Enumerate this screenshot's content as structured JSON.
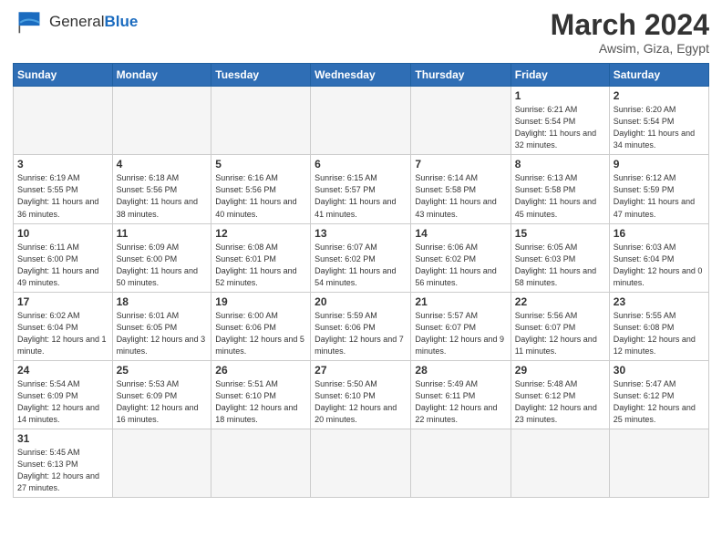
{
  "header": {
    "logo_general": "General",
    "logo_blue": "Blue",
    "month": "March 2024",
    "location": "Awsim, Giza, Egypt"
  },
  "days_of_week": [
    "Sunday",
    "Monday",
    "Tuesday",
    "Wednesday",
    "Thursday",
    "Friday",
    "Saturday"
  ],
  "weeks": [
    [
      {
        "day": "",
        "info": "",
        "empty": true
      },
      {
        "day": "",
        "info": "",
        "empty": true
      },
      {
        "day": "",
        "info": "",
        "empty": true
      },
      {
        "day": "",
        "info": "",
        "empty": true
      },
      {
        "day": "",
        "info": "",
        "empty": true
      },
      {
        "day": "1",
        "info": "Sunrise: 6:21 AM\nSunset: 5:54 PM\nDaylight: 11 hours\nand 32 minutes."
      },
      {
        "day": "2",
        "info": "Sunrise: 6:20 AM\nSunset: 5:54 PM\nDaylight: 11 hours\nand 34 minutes."
      }
    ],
    [
      {
        "day": "3",
        "info": "Sunrise: 6:19 AM\nSunset: 5:55 PM\nDaylight: 11 hours\nand 36 minutes."
      },
      {
        "day": "4",
        "info": "Sunrise: 6:18 AM\nSunset: 5:56 PM\nDaylight: 11 hours\nand 38 minutes."
      },
      {
        "day": "5",
        "info": "Sunrise: 6:16 AM\nSunset: 5:56 PM\nDaylight: 11 hours\nand 40 minutes."
      },
      {
        "day": "6",
        "info": "Sunrise: 6:15 AM\nSunset: 5:57 PM\nDaylight: 11 hours\nand 41 minutes."
      },
      {
        "day": "7",
        "info": "Sunrise: 6:14 AM\nSunset: 5:58 PM\nDaylight: 11 hours\nand 43 minutes."
      },
      {
        "day": "8",
        "info": "Sunrise: 6:13 AM\nSunset: 5:58 PM\nDaylight: 11 hours\nand 45 minutes."
      },
      {
        "day": "9",
        "info": "Sunrise: 6:12 AM\nSunset: 5:59 PM\nDaylight: 11 hours\nand 47 minutes."
      }
    ],
    [
      {
        "day": "10",
        "info": "Sunrise: 6:11 AM\nSunset: 6:00 PM\nDaylight: 11 hours\nand 49 minutes."
      },
      {
        "day": "11",
        "info": "Sunrise: 6:09 AM\nSunset: 6:00 PM\nDaylight: 11 hours\nand 50 minutes."
      },
      {
        "day": "12",
        "info": "Sunrise: 6:08 AM\nSunset: 6:01 PM\nDaylight: 11 hours\nand 52 minutes."
      },
      {
        "day": "13",
        "info": "Sunrise: 6:07 AM\nSunset: 6:02 PM\nDaylight: 11 hours\nand 54 minutes."
      },
      {
        "day": "14",
        "info": "Sunrise: 6:06 AM\nSunset: 6:02 PM\nDaylight: 11 hours\nand 56 minutes."
      },
      {
        "day": "15",
        "info": "Sunrise: 6:05 AM\nSunset: 6:03 PM\nDaylight: 11 hours\nand 58 minutes."
      },
      {
        "day": "16",
        "info": "Sunrise: 6:03 AM\nSunset: 6:04 PM\nDaylight: 12 hours\nand 0 minutes."
      }
    ],
    [
      {
        "day": "17",
        "info": "Sunrise: 6:02 AM\nSunset: 6:04 PM\nDaylight: 12 hours\nand 1 minute."
      },
      {
        "day": "18",
        "info": "Sunrise: 6:01 AM\nSunset: 6:05 PM\nDaylight: 12 hours\nand 3 minutes."
      },
      {
        "day": "19",
        "info": "Sunrise: 6:00 AM\nSunset: 6:06 PM\nDaylight: 12 hours\nand 5 minutes."
      },
      {
        "day": "20",
        "info": "Sunrise: 5:59 AM\nSunset: 6:06 PM\nDaylight: 12 hours\nand 7 minutes."
      },
      {
        "day": "21",
        "info": "Sunrise: 5:57 AM\nSunset: 6:07 PM\nDaylight: 12 hours\nand 9 minutes."
      },
      {
        "day": "22",
        "info": "Sunrise: 5:56 AM\nSunset: 6:07 PM\nDaylight: 12 hours\nand 11 minutes."
      },
      {
        "day": "23",
        "info": "Sunrise: 5:55 AM\nSunset: 6:08 PM\nDaylight: 12 hours\nand 12 minutes."
      }
    ],
    [
      {
        "day": "24",
        "info": "Sunrise: 5:54 AM\nSunset: 6:09 PM\nDaylight: 12 hours\nand 14 minutes."
      },
      {
        "day": "25",
        "info": "Sunrise: 5:53 AM\nSunset: 6:09 PM\nDaylight: 12 hours\nand 16 minutes."
      },
      {
        "day": "26",
        "info": "Sunrise: 5:51 AM\nSunset: 6:10 PM\nDaylight: 12 hours\nand 18 minutes."
      },
      {
        "day": "27",
        "info": "Sunrise: 5:50 AM\nSunset: 6:10 PM\nDaylight: 12 hours\nand 20 minutes."
      },
      {
        "day": "28",
        "info": "Sunrise: 5:49 AM\nSunset: 6:11 PM\nDaylight: 12 hours\nand 22 minutes."
      },
      {
        "day": "29",
        "info": "Sunrise: 5:48 AM\nSunset: 6:12 PM\nDaylight: 12 hours\nand 23 minutes."
      },
      {
        "day": "30",
        "info": "Sunrise: 5:47 AM\nSunset: 6:12 PM\nDaylight: 12 hours\nand 25 minutes."
      }
    ],
    [
      {
        "day": "31",
        "info": "Sunrise: 5:45 AM\nSunset: 6:13 PM\nDaylight: 12 hours\nand 27 minutes.",
        "last": true
      },
      {
        "day": "",
        "info": "",
        "empty": true,
        "last": true
      },
      {
        "day": "",
        "info": "",
        "empty": true,
        "last": true
      },
      {
        "day": "",
        "info": "",
        "empty": true,
        "last": true
      },
      {
        "day": "",
        "info": "",
        "empty": true,
        "last": true
      },
      {
        "day": "",
        "info": "",
        "empty": true,
        "last": true
      },
      {
        "day": "",
        "info": "",
        "empty": true,
        "last": true
      }
    ]
  ]
}
